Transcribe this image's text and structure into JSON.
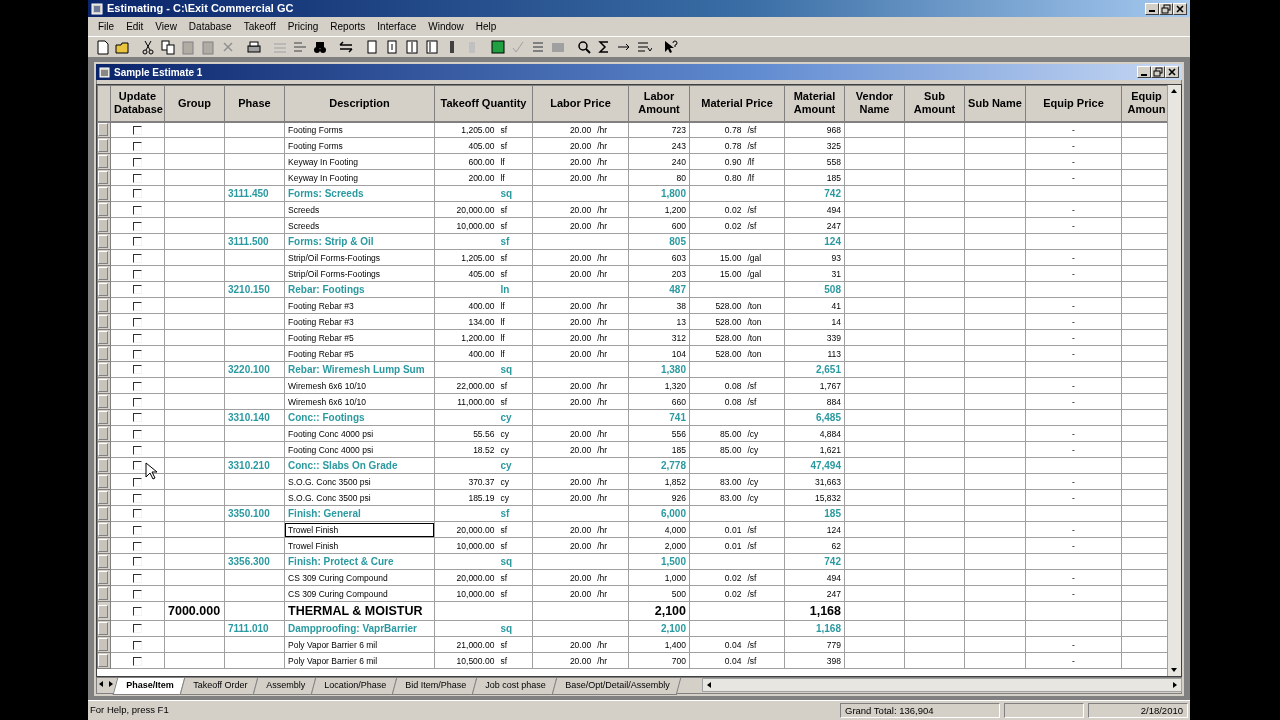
{
  "app_title": "Estimating - C:\\Exit Commercial GC",
  "menu": [
    "File",
    "Edit",
    "View",
    "Database",
    "Takeoff",
    "Pricing",
    "Reports",
    "Interface",
    "Window",
    "Help"
  ],
  "document": {
    "title": "Sample Estimate 1",
    "columns": [
      "Update Database",
      "Group",
      "Phase",
      "Description",
      "Takeoff Quantity",
      "Labor Price",
      "Labor Amount",
      "Material Price",
      "Material Amount",
      "Vendor Name",
      "Sub Amount",
      "Sub Name",
      "Equip Price",
      "Equip Amoun"
    ],
    "rows": [
      {
        "kind": "item",
        "update": false,
        "focused": false,
        "description": "Footing Forms",
        "qty": "1,205.00",
        "qty_unit": "sf",
        "labor_price": "20.00",
        "labor_unit": "/hr",
        "labor_amount": "723",
        "material_price": "0.78",
        "material_unit": "/sf",
        "material_amount": "968",
        "equip_price": "-"
      },
      {
        "kind": "item",
        "update": false,
        "focused": false,
        "description": "Footing Forms",
        "qty": "405.00",
        "qty_unit": "sf",
        "labor_price": "20.00",
        "labor_unit": "/hr",
        "labor_amount": "243",
        "material_price": "0.78",
        "material_unit": "/sf",
        "material_amount": "325",
        "equip_price": "-"
      },
      {
        "kind": "item",
        "update": false,
        "focused": false,
        "description": "Keyway In Footing",
        "qty": "600.00",
        "qty_unit": "lf",
        "labor_price": "20.00",
        "labor_unit": "/hr",
        "labor_amount": "240",
        "material_price": "0.90",
        "material_unit": "/lf",
        "material_amount": "558",
        "equip_price": "-"
      },
      {
        "kind": "item",
        "update": false,
        "focused": false,
        "description": "Keyway In Footing",
        "qty": "200.00",
        "qty_unit": "lf",
        "labor_price": "20.00",
        "labor_unit": "/hr",
        "labor_amount": "80",
        "material_price": "0.80",
        "material_unit": "/lf",
        "material_amount": "185",
        "equip_price": "-"
      },
      {
        "kind": "phase",
        "update": false,
        "focused": false,
        "phase": "3111.450",
        "description": "Forms: Screeds",
        "qty_unit": "sq",
        "labor_amount": "1,800",
        "material_amount": "742"
      },
      {
        "kind": "item",
        "update": false,
        "focused": false,
        "description": "Screeds",
        "qty": "20,000.00",
        "qty_unit": "sf",
        "labor_price": "20.00",
        "labor_unit": "/hr",
        "labor_amount": "1,200",
        "material_price": "0.02",
        "material_unit": "/sf",
        "material_amount": "494",
        "equip_price": "-"
      },
      {
        "kind": "item",
        "update": false,
        "focused": false,
        "description": "Screeds",
        "qty": "10,000.00",
        "qty_unit": "sf",
        "labor_price": "20.00",
        "labor_unit": "/hr",
        "labor_amount": "600",
        "material_price": "0.02",
        "material_unit": "/sf",
        "material_amount": "247",
        "equip_price": "-"
      },
      {
        "kind": "phase",
        "update": false,
        "focused": false,
        "phase": "3111.500",
        "description": "Forms: Strip & Oil",
        "qty_unit": "sf",
        "labor_amount": "805",
        "material_amount": "124"
      },
      {
        "kind": "item",
        "update": false,
        "focused": false,
        "description": "Strip/Oil Forms-Footings",
        "qty": "1,205.00",
        "qty_unit": "sf",
        "labor_price": "20.00",
        "labor_unit": "/hr",
        "labor_amount": "603",
        "material_price": "15.00",
        "material_unit": "/gal",
        "material_amount": "93",
        "equip_price": "-"
      },
      {
        "kind": "item",
        "update": false,
        "focused": false,
        "description": "Strip/Oil Forms-Footings",
        "qty": "405.00",
        "qty_unit": "sf",
        "labor_price": "20.00",
        "labor_unit": "/hr",
        "labor_amount": "203",
        "material_price": "15.00",
        "material_unit": "/gal",
        "material_amount": "31",
        "equip_price": "-"
      },
      {
        "kind": "phase",
        "update": false,
        "focused": false,
        "phase": "3210.150",
        "description": "Rebar: Footings",
        "qty_unit": "ln",
        "labor_amount": "487",
        "material_amount": "508"
      },
      {
        "kind": "item",
        "update": false,
        "focused": false,
        "description": "Footing Rebar #3",
        "qty": "400.00",
        "qty_unit": "lf",
        "labor_price": "20.00",
        "labor_unit": "/hr",
        "labor_amount": "38",
        "material_price": "528.00",
        "material_unit": "/ton",
        "material_amount": "41",
        "equip_price": "-"
      },
      {
        "kind": "item",
        "update": false,
        "focused": false,
        "description": "Footing Rebar #3",
        "qty": "134.00",
        "qty_unit": "lf",
        "labor_price": "20.00",
        "labor_unit": "/hr",
        "labor_amount": "13",
        "material_price": "528.00",
        "material_unit": "/ton",
        "material_amount": "14",
        "equip_price": "-"
      },
      {
        "kind": "item",
        "update": false,
        "focused": false,
        "description": "Footing Rebar #5",
        "qty": "1,200.00",
        "qty_unit": "lf",
        "labor_price": "20.00",
        "labor_unit": "/hr",
        "labor_amount": "312",
        "material_price": "528.00",
        "material_unit": "/ton",
        "material_amount": "339",
        "equip_price": "-"
      },
      {
        "kind": "item",
        "update": false,
        "focused": false,
        "description": "Footing Rebar #5",
        "qty": "400.00",
        "qty_unit": "lf",
        "labor_price": "20.00",
        "labor_unit": "/hr",
        "labor_amount": "104",
        "material_price": "528.00",
        "material_unit": "/ton",
        "material_amount": "113",
        "equip_price": "-"
      },
      {
        "kind": "phase",
        "update": false,
        "focused": false,
        "phase": "3220.100",
        "description": "Rebar: Wiremesh Lump Sum",
        "qty_unit": "sq",
        "labor_amount": "1,380",
        "material_amount": "2,651"
      },
      {
        "kind": "item",
        "update": false,
        "focused": false,
        "description": "Wiremesh 6x6 10/10",
        "qty": "22,000.00",
        "qty_unit": "sf",
        "labor_price": "20.00",
        "labor_unit": "/hr",
        "labor_amount": "1,320",
        "material_price": "0.08",
        "material_unit": "/sf",
        "material_amount": "1,767",
        "equip_price": "-"
      },
      {
        "kind": "item",
        "update": false,
        "focused": false,
        "description": "Wiremesh 6x6 10/10",
        "qty": "11,000.00",
        "qty_unit": "sf",
        "labor_price": "20.00",
        "labor_unit": "/hr",
        "labor_amount": "660",
        "material_price": "0.08",
        "material_unit": "/sf",
        "material_amount": "884",
        "equip_price": "-"
      },
      {
        "kind": "phase",
        "update": false,
        "focused": false,
        "phase": "3310.140",
        "description": "Conc:: Footings",
        "qty_unit": "cy",
        "labor_amount": "741",
        "material_amount": "6,485"
      },
      {
        "kind": "item",
        "update": false,
        "focused": false,
        "description": "Footing Conc 4000 psi",
        "qty": "55.56",
        "qty_unit": "cy",
        "labor_price": "20.00",
        "labor_unit": "/hr",
        "labor_amount": "556",
        "material_price": "85.00",
        "material_unit": "/cy",
        "material_amount": "4,884",
        "equip_price": "-"
      },
      {
        "kind": "item",
        "update": false,
        "focused": false,
        "description": "Footing Conc 4000 psi",
        "qty": "18.52",
        "qty_unit": "cy",
        "labor_price": "20.00",
        "labor_unit": "/hr",
        "labor_amount": "185",
        "material_price": "85.00",
        "material_unit": "/cy",
        "material_amount": "1,621",
        "equip_price": "-"
      },
      {
        "kind": "phase",
        "update": false,
        "focused": false,
        "phase": "3310.210",
        "description": "Conc:: Slabs On Grade",
        "qty_unit": "cy",
        "labor_amount": "2,778",
        "material_amount": "47,494"
      },
      {
        "kind": "item",
        "update": false,
        "focused": false,
        "description": "S.O.G. Conc 3500 psi",
        "qty": "370.37",
        "qty_unit": "cy",
        "labor_price": "20.00",
        "labor_unit": "/hr",
        "labor_amount": "1,852",
        "material_price": "83.00",
        "material_unit": "/cy",
        "material_amount": "31,663",
        "equip_price": "-"
      },
      {
        "kind": "item",
        "update": false,
        "focused": false,
        "description": "S.O.G. Conc 3500 psi",
        "qty": "185.19",
        "qty_unit": "cy",
        "labor_price": "20.00",
        "labor_unit": "/hr",
        "labor_amount": "926",
        "material_price": "83.00",
        "material_unit": "/cy",
        "material_amount": "15,832",
        "equip_price": "-"
      },
      {
        "kind": "phase",
        "update": false,
        "focused": false,
        "phase": "3350.100",
        "description": "Finish: General",
        "qty_unit": "sf",
        "labor_amount": "6,000",
        "material_amount": "185"
      },
      {
        "kind": "item",
        "update": false,
        "focused": true,
        "description": "Trowel Finish",
        "qty": "20,000.00",
        "qty_unit": "sf",
        "labor_price": "20.00",
        "labor_unit": "/hr",
        "labor_amount": "4,000",
        "material_price": "0.01",
        "material_unit": "/sf",
        "material_amount": "124",
        "equip_price": "-"
      },
      {
        "kind": "item",
        "update": false,
        "focused": false,
        "description": "Trowel Finish",
        "qty": "10,000.00",
        "qty_unit": "sf",
        "labor_price": "20.00",
        "labor_unit": "/hr",
        "labor_amount": "2,000",
        "material_price": "0.01",
        "material_unit": "/sf",
        "material_amount": "62",
        "equip_price": "-"
      },
      {
        "kind": "phase",
        "update": false,
        "focused": false,
        "phase": "3356.300",
        "description": "Finish: Protect & Cure",
        "qty_unit": "sq",
        "labor_amount": "1,500",
        "material_amount": "742"
      },
      {
        "kind": "item",
        "update": false,
        "focused": false,
        "description": "CS 309 Curing Compound",
        "qty": "20,000.00",
        "qty_unit": "sf",
        "labor_price": "20.00",
        "labor_unit": "/hr",
        "labor_amount": "1,000",
        "material_price": "0.02",
        "material_unit": "/sf",
        "material_amount": "494",
        "equip_price": "-"
      },
      {
        "kind": "item",
        "update": false,
        "focused": false,
        "description": "CS 309 Curing Compound",
        "qty": "10,000.00",
        "qty_unit": "sf",
        "labor_price": "20.00",
        "labor_unit": "/hr",
        "labor_amount": "500",
        "material_price": "0.02",
        "material_unit": "/sf",
        "material_amount": "247",
        "equip_price": "-"
      },
      {
        "kind": "group",
        "update": false,
        "focused": false,
        "group": "7000.000",
        "description": "THERMAL & MOISTUR",
        "labor_amount": "2,100",
        "material_amount": "1,168"
      },
      {
        "kind": "phase",
        "update": false,
        "focused": false,
        "phase": "7111.010",
        "description": "Dampproofing: VaprBarrier",
        "qty_unit": "sq",
        "labor_amount": "2,100",
        "material_amount": "1,168"
      },
      {
        "kind": "item",
        "update": false,
        "focused": false,
        "description": "Poly Vapor Barrier 6 mil",
        "qty": "21,000.00",
        "qty_unit": "sf",
        "labor_price": "20.00",
        "labor_unit": "/hr",
        "labor_amount": "1,400",
        "material_price": "0.04",
        "material_unit": "/sf",
        "material_amount": "779",
        "equip_price": "-"
      },
      {
        "kind": "item",
        "update": false,
        "focused": false,
        "description": "Poly Vapor Barrier 6 mil",
        "qty": "10,500.00",
        "qty_unit": "sf",
        "labor_price": "20.00",
        "labor_unit": "/hr",
        "labor_amount": "700",
        "material_price": "0.04",
        "material_unit": "/sf",
        "material_amount": "398",
        "equip_price": "-"
      }
    ],
    "tabs": [
      {
        "label": "Phase/Item",
        "selected": true
      },
      {
        "label": "Takeoff Order",
        "selected": false
      },
      {
        "label": "Assembly",
        "selected": false
      },
      {
        "label": "Location/Phase",
        "selected": false
      },
      {
        "label": "Bid Item/Phase",
        "selected": false
      },
      {
        "label": "Job cost phase",
        "selected": false
      },
      {
        "label": "Base/Opt/Detail/Assembly",
        "selected": false
      }
    ]
  },
  "status_bar": {
    "help": "For Help, press F1",
    "grand_total": "Grand Total: 136,904",
    "date": "2/18/2010"
  }
}
